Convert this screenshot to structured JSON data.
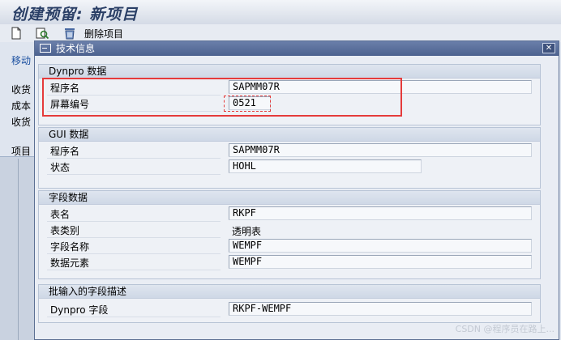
{
  "window": {
    "title": "创建预留: 新项目"
  },
  "toolbar": {
    "delete_label": "删除项目"
  },
  "background": {
    "move_label": "移动",
    "labels": [
      "收货",
      "成本",
      "收货"
    ],
    "tab_label": "项目"
  },
  "dialog": {
    "title": "技术信息",
    "close_label": "✕",
    "dynpro": {
      "header": "Dynpro 数据",
      "program_label": "程序名",
      "program_value": "SAPMM07R",
      "screen_label": "屏幕编号",
      "screen_value": "0521"
    },
    "gui": {
      "header": "GUI 数据",
      "program_label": "程序名",
      "program_value": "SAPMM07R",
      "status_label": "状态",
      "status_value": "HOHL"
    },
    "field": {
      "header": "字段数据",
      "table_label": "表名",
      "table_value": "RKPF",
      "table_type_label": "表类别",
      "table_type_value": "透明表",
      "field_label": "字段名称",
      "field_value": "WEMPF",
      "data_element_label": "数据元素",
      "data_element_value": "WEMPF"
    },
    "batch": {
      "header": "批输入的字段描述",
      "dynpro_field_label": "Dynpro 字段",
      "dynpro_field_value": "RKPF-WEMPF"
    }
  },
  "watermark": "CSDN @程序员在路上..."
}
